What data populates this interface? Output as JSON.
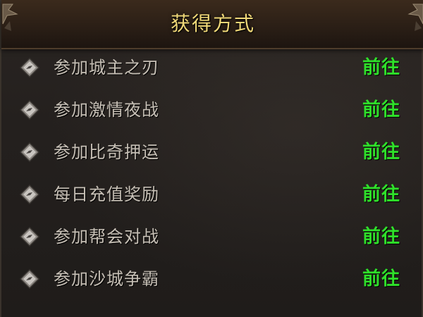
{
  "header": {
    "title": "获得方式"
  },
  "methods": [
    {
      "label": "参加城主之刃",
      "action": "前往",
      "icon": "diamond-bullet-icon"
    },
    {
      "label": "参加激情夜战",
      "action": "前往",
      "icon": "diamond-bullet-icon"
    },
    {
      "label": "参加比奇押运",
      "action": "前往",
      "icon": "diamond-bullet-icon"
    },
    {
      "label": "每日充值奖励",
      "action": "前往",
      "icon": "diamond-bullet-icon"
    },
    {
      "label": "参加帮会对战",
      "action": "前往",
      "icon": "diamond-bullet-icon"
    },
    {
      "label": "参加沙城争霸",
      "action": "前往",
      "icon": "diamond-bullet-icon"
    }
  ],
  "colors": {
    "title": "#f0d878",
    "label": "#c7c0b6",
    "action": "#2fe02a",
    "background": "#24201e"
  }
}
